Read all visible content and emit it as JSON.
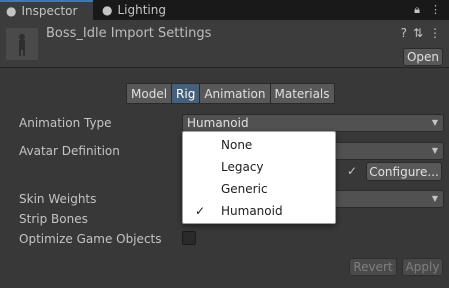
{
  "tabs": [
    {
      "label": "Inspector",
      "icon": "info-icon"
    },
    {
      "label": "Lighting",
      "icon": "bulb-icon"
    }
  ],
  "header": {
    "title": "Boss_Idle Import Settings",
    "open_label": "Open"
  },
  "subtabs": [
    "Model",
    "Rig",
    "Animation",
    "Materials"
  ],
  "selected_subtab": "Rig",
  "fields": {
    "animation_type_label": "Animation Type",
    "animation_type_value": "Humanoid",
    "avatar_definition_label": "Avatar Definition",
    "configure_label": "Configure...",
    "skin_weights_label": "Skin Weights",
    "strip_bones_label": "Strip Bones",
    "optimize_label": "Optimize Game Objects"
  },
  "footer": {
    "revert_label": "Revert",
    "apply_label": "Apply"
  },
  "popup": {
    "items": [
      {
        "label": "None",
        "checked": false
      },
      {
        "label": "Legacy",
        "checked": false
      },
      {
        "label": "Generic",
        "checked": false
      },
      {
        "label": "Humanoid",
        "checked": true
      }
    ],
    "check_glyph": "✓"
  },
  "colors": {
    "accent": "#3a79bb",
    "selected_tab": "#46607c"
  }
}
